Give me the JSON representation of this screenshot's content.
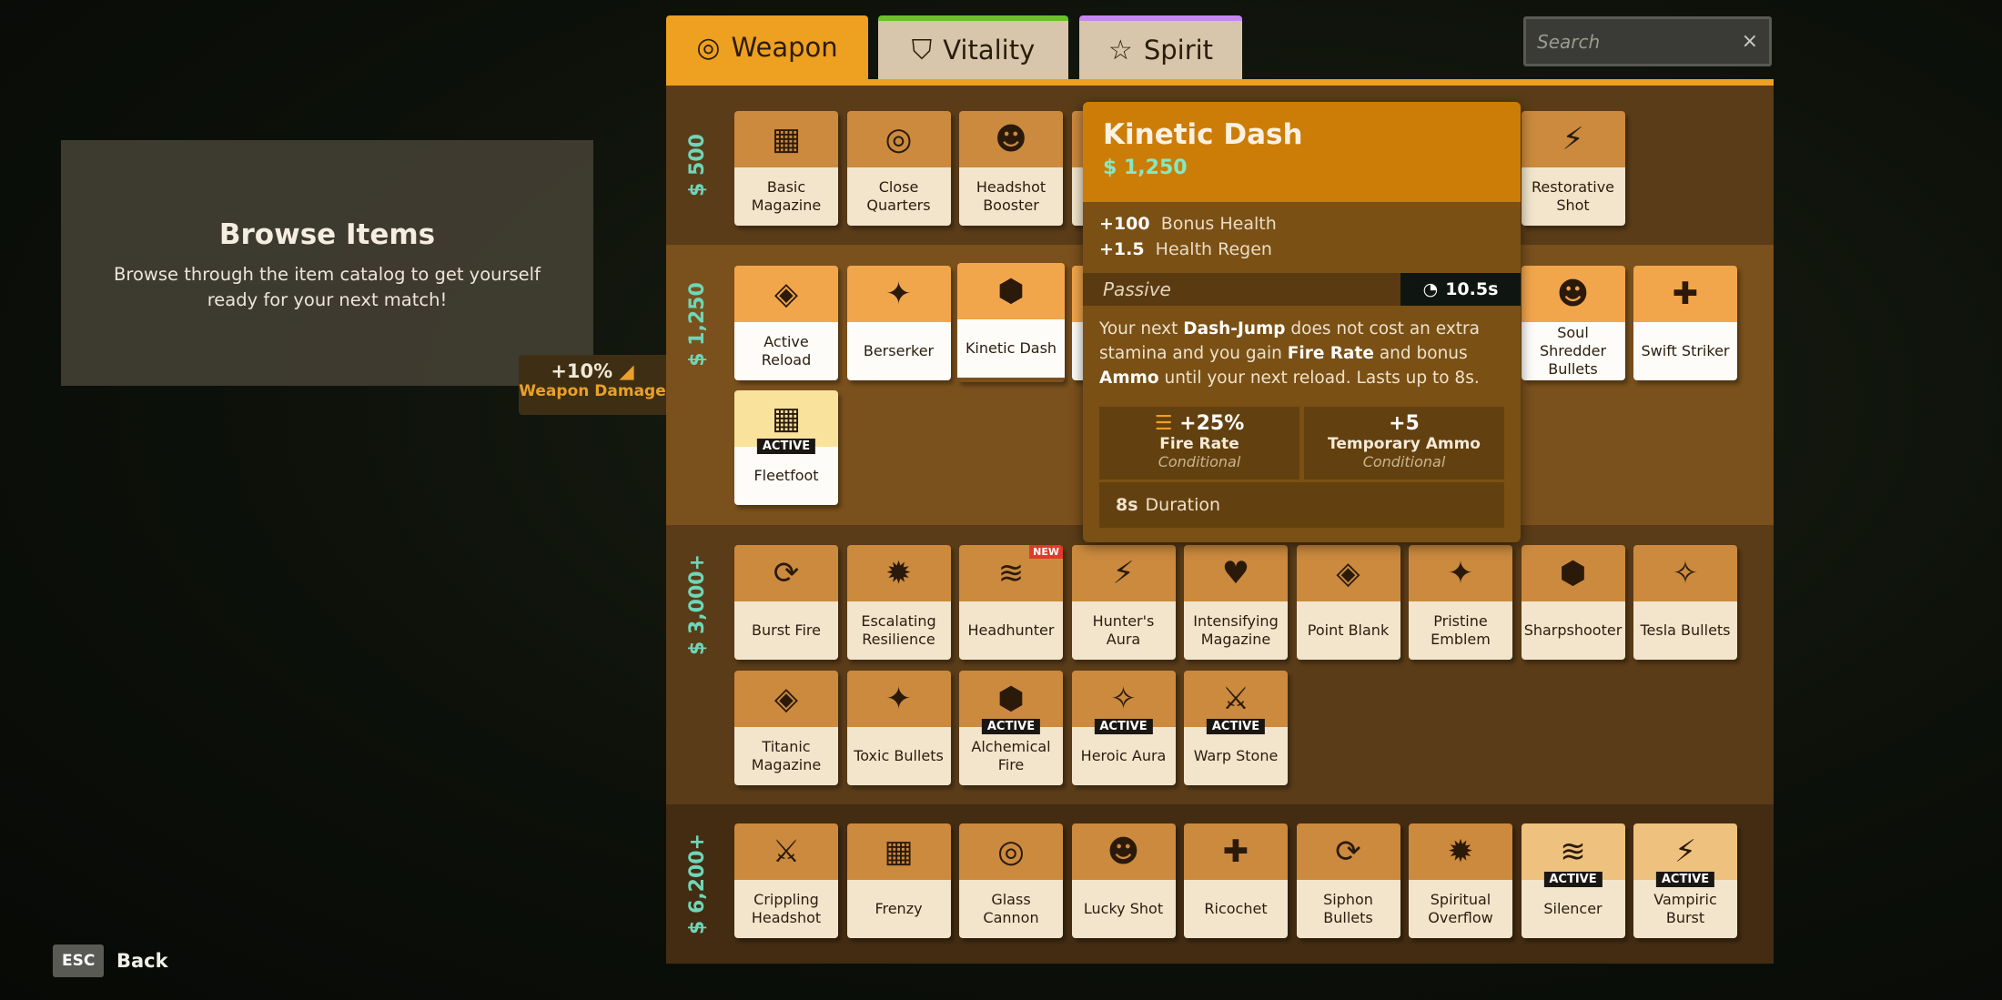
{
  "tabs": [
    {
      "label": "Weapon",
      "icon": "weapon-target-icon",
      "accent": "#eea021",
      "active": true
    },
    {
      "label": "Vitality",
      "icon": "vitality-shield-icon",
      "accent": "#6cbf2a"
    },
    {
      "label": "Spirit",
      "icon": "spirit-star-icon",
      "accent": "#c587ef"
    }
  ],
  "search": {
    "placeholder": "Search",
    "clear": "×"
  },
  "browse": {
    "title": "Browse Items",
    "text": "Browse through the item catalog to get yourself ready for your next match!"
  },
  "bonus": {
    "value": "+10%",
    "label": "Weapon Damage"
  },
  "footer": {
    "key": "ESC",
    "label": "Back"
  },
  "tiers": [
    {
      "cost": "$ 500",
      "bg": "#5a3c18",
      "rows": [
        [
          "Basic Magazine",
          "Close Quarters",
          "Headshot Booster",
          "",
          "",
          "",
          "",
          "Restorative Shot"
        ]
      ]
    },
    {
      "cost": "$ 1,250",
      "bg": "#7a501d",
      "affordable": true,
      "rows": [
        [
          "Active Reload",
          "Berserker",
          "Kinetic Dash",
          "",
          "",
          "",
          "",
          "Soul Shredder Bullets",
          "Swift Striker"
        ],
        [
          "Fleetfoot"
        ]
      ]
    },
    {
      "cost": "$ 3,000+",
      "bg": "#5a3c18",
      "rows": [
        [
          "Burst Fire",
          "Escalating Resilience",
          "Headhunter",
          "Hunter's Aura",
          "Intensifying Magazine",
          "Point Blank",
          "Pristine Emblem",
          "Sharpshooter",
          "Tesla Bullets"
        ],
        [
          "Titanic Magazine",
          "Toxic Bullets",
          "Alchemical Fire",
          "Heroic Aura",
          "Warp Stone"
        ]
      ]
    },
    {
      "cost": "$ 6,200+",
      "bg": "#432c12",
      "rows": [
        [
          "Crippling Headshot",
          "Frenzy",
          "Glass Cannon",
          "Lucky Shot",
          "Ricochet",
          "Siphon Bullets",
          "Spiritual Overflow",
          "Silencer",
          "Vampiric Burst"
        ]
      ]
    }
  ],
  "active_items": [
    "Fleetfoot",
    "Alchemical Fire",
    "Heroic Aura",
    "Warp Stone",
    "Silencer",
    "Vampiric Burst"
  ],
  "active_label": "ACTIVE",
  "new_items": [
    "Headhunter"
  ],
  "new_label": "NEW",
  "tooltip": {
    "title": "Kinetic Dash",
    "cost": "1,250",
    "stats": [
      {
        "value": "+100",
        "label": "Bonus Health"
      },
      {
        "value": "+1.5",
        "label": "Health Regen"
      }
    ],
    "type": "Passive",
    "cooldown": "10.5s",
    "desc_parts": [
      "Your next ",
      "Dash-Jump",
      " does not cost an extra stamina and you gain ",
      "Fire Rate",
      " and bonus ",
      "Ammo",
      " until your next reload. Lasts up to 8s."
    ],
    "boxes": [
      {
        "value": "+25%",
        "name": "Fire Rate",
        "note": "Conditional"
      },
      {
        "value": "+5",
        "name": "Temporary Ammo",
        "note": "Conditional"
      }
    ],
    "duration": {
      "value": "8s",
      "label": "Duration"
    }
  },
  "colors": {
    "cost": "#6fd6b8",
    "accent": "#eea021"
  }
}
